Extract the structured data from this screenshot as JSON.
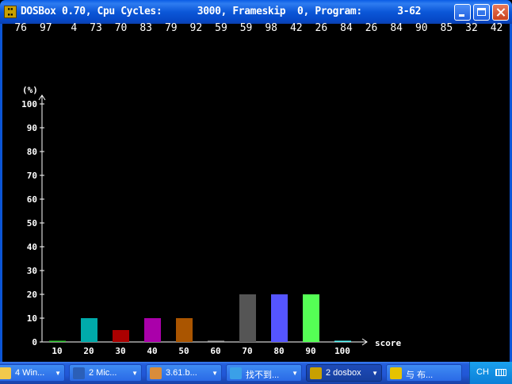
{
  "window": {
    "title": "DOSBox 0.70, Cpu Cycles:      3000, Frameskip  0, Program:      3-62",
    "icon": "dosbox-icon"
  },
  "score_line": [
    76,
    97,
    4,
    73,
    70,
    83,
    79,
    92,
    59,
    59,
    98,
    42,
    26,
    84,
    26,
    84,
    90,
    85,
    32,
    42
  ],
  "chart_data": {
    "type": "bar",
    "ylabel": "(%)",
    "xlabel": "score",
    "categories": [
      "10",
      "20",
      "30",
      "40",
      "50",
      "60",
      "70",
      "80",
      "90",
      "100"
    ],
    "values": [
      0,
      10,
      5,
      10,
      10,
      0,
      20,
      20,
      20,
      0
    ],
    "bar_colors": [
      "#33cc33",
      "#00aaaa",
      "#aa0000",
      "#aa00aa",
      "#aa5500",
      "#aaaaaa",
      "#555555",
      "#5555ff",
      "#55ff55",
      "#55ffff"
    ],
    "ylim": [
      0,
      100
    ],
    "yticks": [
      0,
      10,
      20,
      30,
      40,
      50,
      60,
      70,
      80,
      90,
      100
    ],
    "grid": false
  },
  "taskbar": {
    "items": [
      {
        "label": "4 Win...",
        "icon": "folder-icon",
        "active": false
      },
      {
        "label": "2 Mic...",
        "icon": "word-icon",
        "active": false
      },
      {
        "label": "3.61.b...",
        "icon": "paint-icon",
        "active": false
      },
      {
        "label": "找不到...",
        "icon": "ie-icon",
        "active": false
      },
      {
        "label": "2 dosbox",
        "icon": "dosbox-icon",
        "active": true
      },
      {
        "label": "与 布...",
        "icon": "chat-icon",
        "active": false
      }
    ],
    "tray": {
      "language": "CH",
      "icon": "keyboard-icon"
    }
  }
}
